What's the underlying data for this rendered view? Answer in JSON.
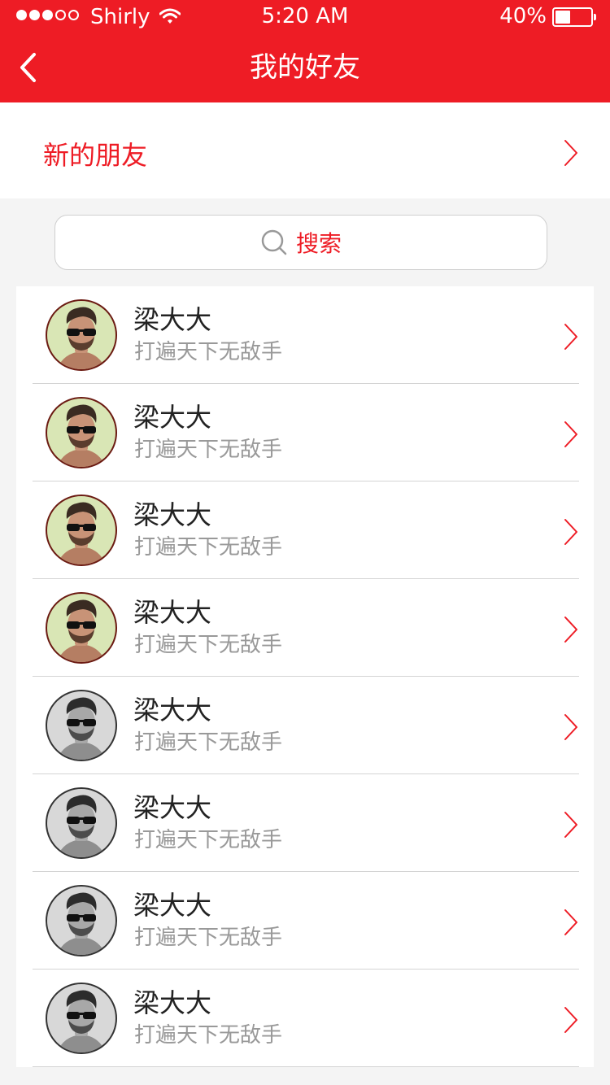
{
  "status_bar": {
    "carrier": "Shirly",
    "time": "5:20 AM",
    "battery": "40%",
    "signal_bars_filled": 3,
    "signal_bars_total": 5
  },
  "nav": {
    "title": "我的好友",
    "back_icon": "chevron-left-icon"
  },
  "new_friends": {
    "label": "新的朋友",
    "icon": "chevron-right-icon"
  },
  "search": {
    "icon": "search-icon",
    "label": "搜索"
  },
  "colors": {
    "accent": "#ee1c25",
    "background": "#f4f4f4",
    "divider": "#d4d4d4",
    "secondary_text": "#999999"
  },
  "friends": [
    {
      "name": "梁大大",
      "motto": "打遍天下无敌手",
      "avatar_style": "color"
    },
    {
      "name": "梁大大",
      "motto": "打遍天下无敌手",
      "avatar_style": "color"
    },
    {
      "name": "梁大大",
      "motto": "打遍天下无敌手",
      "avatar_style": "color"
    },
    {
      "name": "梁大大",
      "motto": "打遍天下无敌手",
      "avatar_style": "color"
    },
    {
      "name": "梁大大",
      "motto": "打遍天下无敌手",
      "avatar_style": "gray"
    },
    {
      "name": "梁大大",
      "motto": "打遍天下无敌手",
      "avatar_style": "gray"
    },
    {
      "name": "梁大大",
      "motto": "打遍天下无敌手",
      "avatar_style": "gray"
    },
    {
      "name": "梁大大",
      "motto": "打遍天下无敌手",
      "avatar_style": "gray"
    }
  ]
}
